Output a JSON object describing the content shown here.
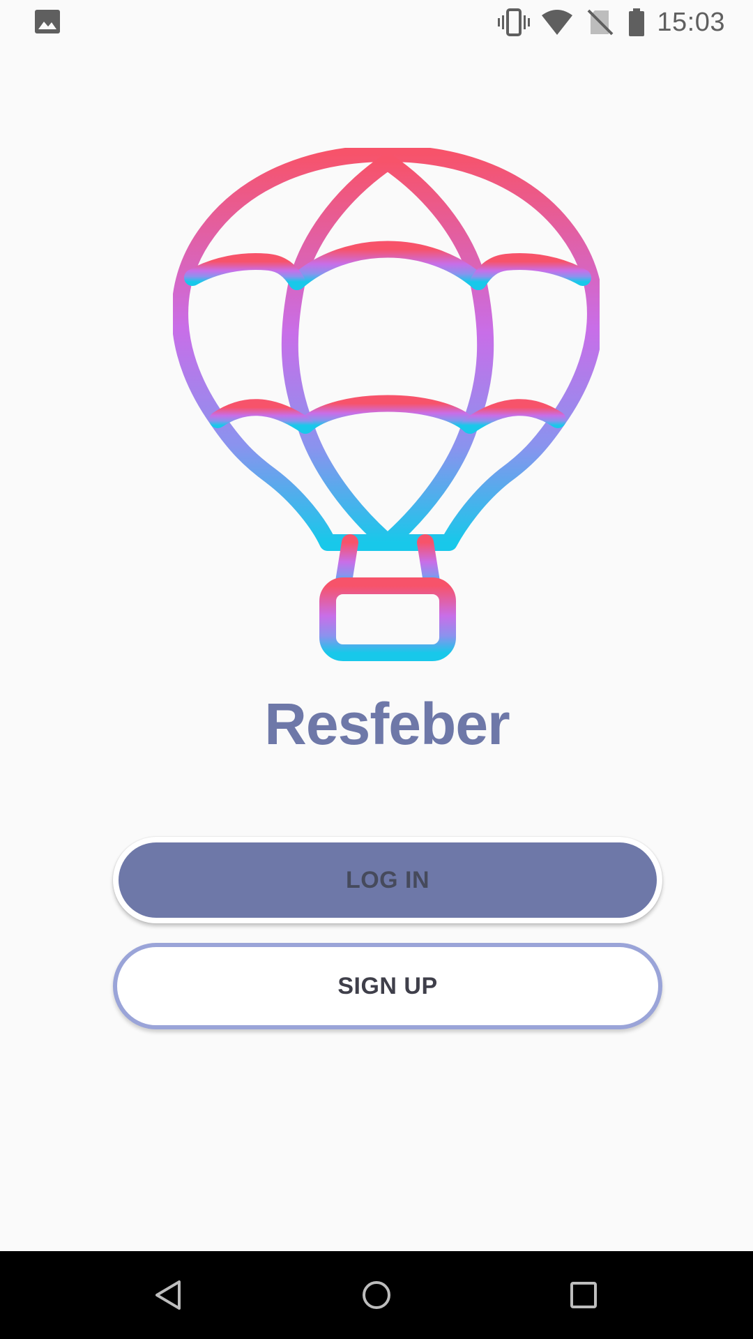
{
  "status_bar": {
    "time": "15:03",
    "left_icon": "image-icon",
    "icons": [
      "vibrate-icon",
      "wifi-icon",
      "no-sim-icon",
      "battery-icon"
    ]
  },
  "app": {
    "name": "Resfeber",
    "logo_icon": "hot-air-balloon-icon",
    "gradient_colors": [
      "#f7536a",
      "#c86ee8",
      "#18c8ea"
    ],
    "brand_color": "#6e78a8"
  },
  "actions": {
    "login_label": "LOG IN",
    "signup_label": "SIGN UP"
  },
  "nav_bar": {
    "icons": [
      "back-icon",
      "home-icon",
      "recents-icon"
    ]
  }
}
